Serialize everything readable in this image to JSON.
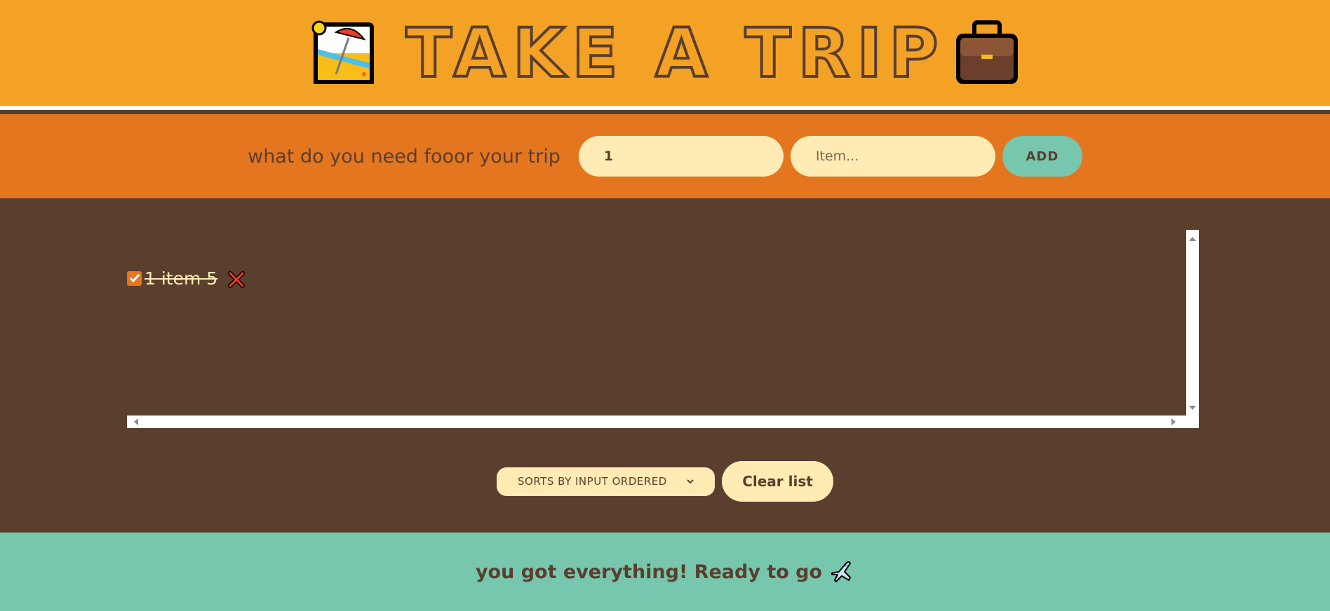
{
  "header": {
    "title": "TAKE A TRIP",
    "left_icon": "beach-umbrella-icon",
    "right_icon": "briefcase-icon"
  },
  "form": {
    "prompt": "what do you need fooor your trip",
    "quantity_value": "1",
    "item_placeholder": "Item...",
    "add_label": "ADD"
  },
  "list": {
    "items": [
      {
        "text": "1 item 5",
        "packed": true,
        "delete_icon": "cross-mark-icon"
      }
    ]
  },
  "actions": {
    "sort_selected": "SORTS BY INPUT ORDERED",
    "clear_label": "Clear list"
  },
  "footer": {
    "message": "you got everything! Ready to go",
    "icon": "airplane-icon"
  },
  "colors": {
    "header_bg": "#f4a226",
    "form_bg": "#e4761f",
    "main_bg": "#5a3e2e",
    "footer_bg": "#76c7ad",
    "pill_bg": "#ffebb3"
  }
}
